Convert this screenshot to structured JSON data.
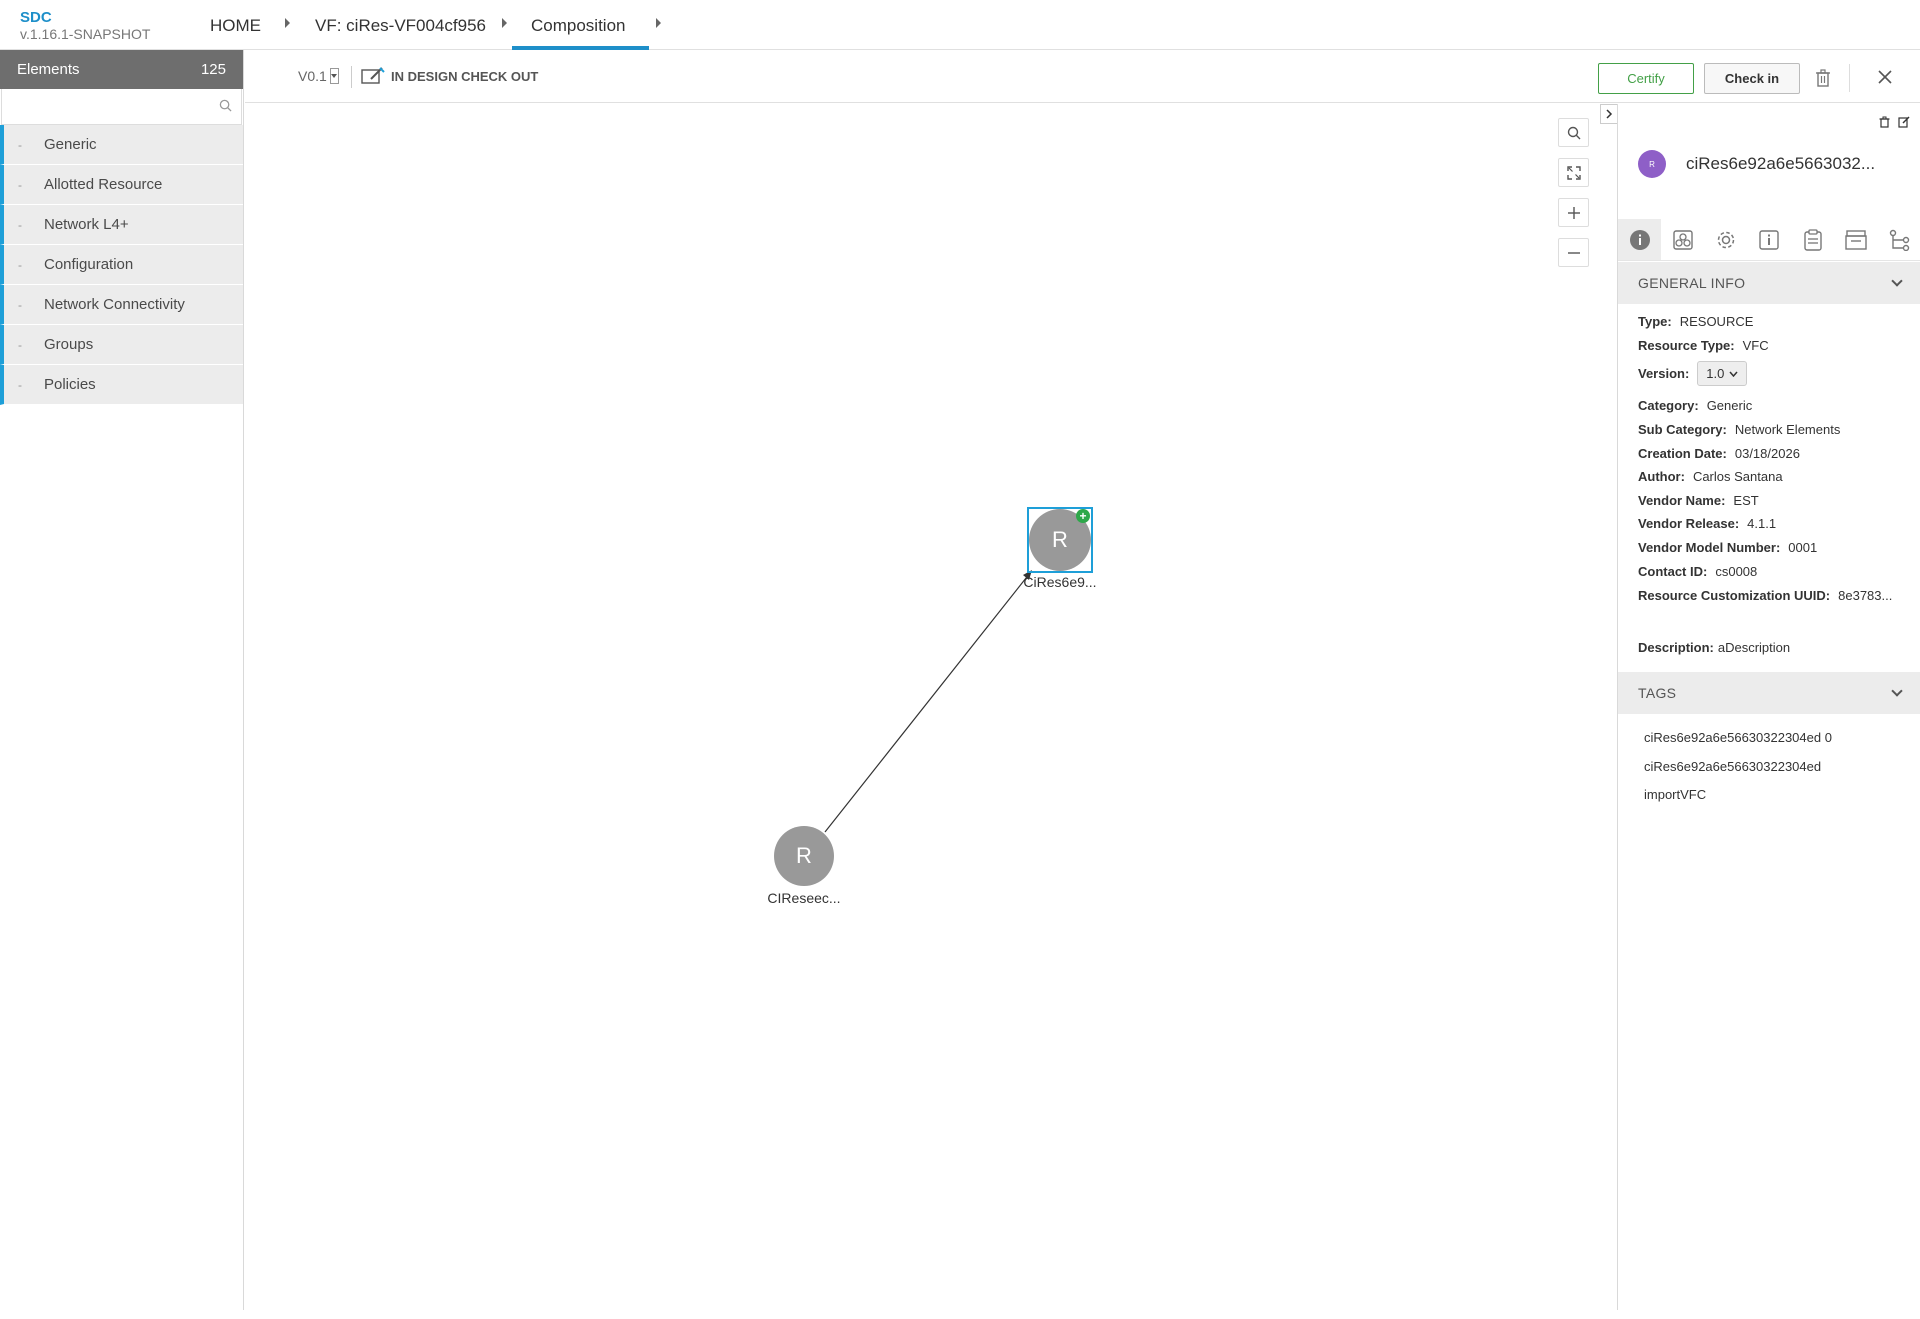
{
  "app": {
    "name": "SDC",
    "version": "v.1.16.1-SNAPSHOT"
  },
  "breadcrumb": {
    "home": "HOME",
    "vf": "VF: ciRes-VF004cf956",
    "composition": "Composition"
  },
  "elements_panel": {
    "title": "Elements",
    "count": "125",
    "search_placeholder": "",
    "items": [
      {
        "label": "Generic"
      },
      {
        "label": "Allotted Resource"
      },
      {
        "label": "Network L4+"
      },
      {
        "label": "Configuration"
      },
      {
        "label": "Network Connectivity"
      },
      {
        "label": "Groups"
      },
      {
        "label": "Policies"
      }
    ]
  },
  "toolbar": {
    "version": "V0.1",
    "status": "IN DESIGN CHECK OUT",
    "certify_label": "Certify",
    "checkin_label": "Check in"
  },
  "canvas": {
    "nodes": [
      {
        "letter": "R",
        "label": "CiRes6e9..."
      },
      {
        "letter": "R",
        "label": "CIReseec..."
      }
    ]
  },
  "details": {
    "avatar_letter": "R",
    "title": "ciRes6e92a6e5663032...",
    "general_info_header": "GENERAL INFO",
    "fields": {
      "type_label": "Type:",
      "type": "RESOURCE",
      "resource_type_label": "Resource Type:",
      "resource_type": "VFC",
      "version_label": "Version:",
      "version": "1.0",
      "category_label": "Category:",
      "category": "Generic",
      "sub_category_label": "Sub Category:",
      "sub_category": "Network Elements",
      "creation_date_label": "Creation Date:",
      "creation_date": "03/18/2026",
      "author_label": "Author:",
      "author": "Carlos Santana",
      "vendor_name_label": "Vendor Name:",
      "vendor_name": "EST",
      "vendor_release_label": "Vendor Release:",
      "vendor_release": "4.1.1",
      "vendor_model_label": "Vendor Model Number:",
      "vendor_model": "0001",
      "contact_id_label": "Contact ID:",
      "contact_id": "cs0008",
      "customization_uuid_label": "Resource Customization UUID:",
      "customization_uuid": "8e3783...",
      "description_label": "Description:",
      "description": "aDescription"
    },
    "tags_header": "TAGS",
    "tags": [
      "ciRes6e92a6e56630322304ed 0",
      "ciRes6e92a6e56630322304ed",
      "importVFC"
    ]
  },
  "colors": {
    "accent": "#1e9fd8",
    "certify": "#43a047",
    "node": "#999999",
    "avatar": "#8e5fc7"
  }
}
